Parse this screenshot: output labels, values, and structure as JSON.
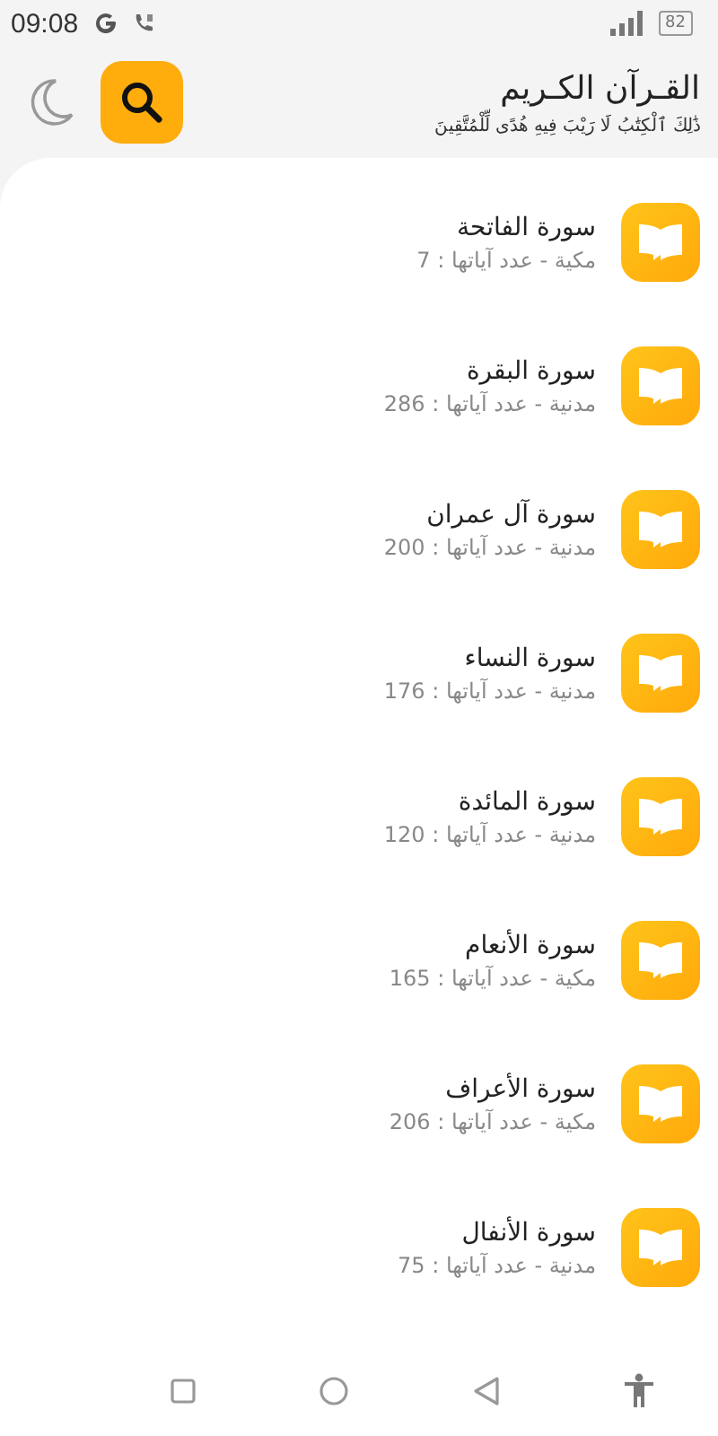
{
  "status_bar": {
    "time": "09:08",
    "battery": "82"
  },
  "header": {
    "title": "القـرآن الكـريم",
    "subtitle": "ذَٰلِكَ ٱلْكِتَٰبُ لَا رَيْبَ فِيهِ هُدًى لِّلْمُتَّقِينَ"
  },
  "surahs": [
    {
      "name": "سورة الفاتحة",
      "info": "مكية - عدد آياتها : 7"
    },
    {
      "name": "سورة البقرة",
      "info": "مدنية - عدد آياتها : 286"
    },
    {
      "name": "سورة آل عمران",
      "info": "مدنية - عدد آياتها : 200"
    },
    {
      "name": "سورة النساء",
      "info": "مدنية - عدد آياتها : 176"
    },
    {
      "name": "سورة المائدة",
      "info": "مدنية - عدد آياتها : 120"
    },
    {
      "name": "سورة الأنعام",
      "info": "مكية - عدد آياتها : 165"
    },
    {
      "name": "سورة الأعراف",
      "info": "مكية - عدد آياتها : 206"
    },
    {
      "name": "سورة الأنفال",
      "info": "مدنية - عدد آياتها : 75"
    }
  ]
}
